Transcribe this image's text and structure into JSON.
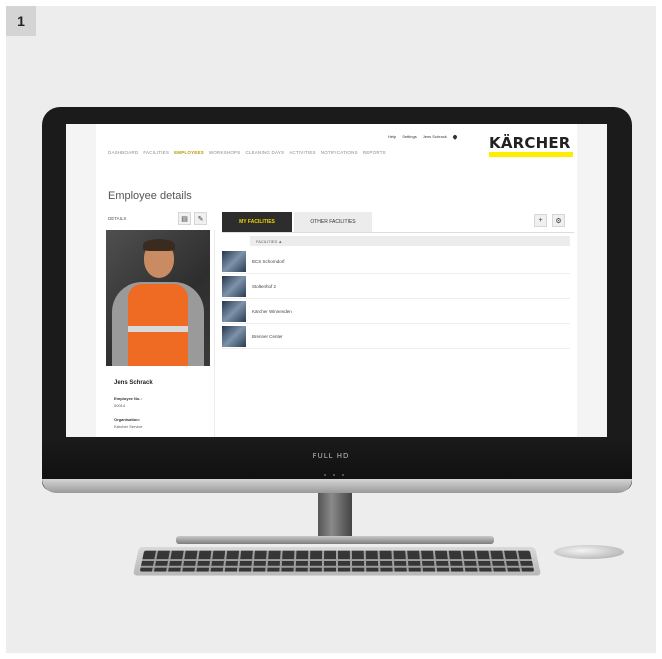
{
  "step_badge": "1",
  "monitor": {
    "brand_label": "FULL HD"
  },
  "app": {
    "util_nav": [
      "Help",
      "Settings",
      "Jens Schrack"
    ],
    "logo": "KÄRCHER",
    "logo_color": "#ffed00",
    "main_nav": [
      {
        "label": "DASHBOARD",
        "active": false
      },
      {
        "label": "FACILITIES",
        "active": false
      },
      {
        "label": "EMPLOYEES",
        "active": true
      },
      {
        "label": "WORKSHOPS",
        "active": false
      },
      {
        "label": "CLEANING DAYS",
        "active": false
      },
      {
        "label": "ACTIVITIES",
        "active": false
      },
      {
        "label": "NOTIFICATIONS",
        "active": false
      },
      {
        "label": "REPORTS",
        "active": false
      }
    ],
    "page_title": "Employee details",
    "details_label": "DETAILS",
    "employee": {
      "name": "Jens Schrack",
      "employee_no_label": "Employee No.:",
      "employee_no": "00014",
      "organisation_label": "Organisation:",
      "organisation": "Kärcher Service"
    },
    "tabs": [
      {
        "label": "MY FACILITIES",
        "active": true
      },
      {
        "label": "OTHER FACILITIES",
        "active": false
      }
    ],
    "table_header": "FACILITIES ▲",
    "facilities": [
      "BCS Schorndorf",
      "Stoltenhof 2",
      "Kärcher Winnenden",
      "Brenner Center"
    ],
    "icons": {
      "calendar": "calendar-icon",
      "edit": "pencil-icon",
      "add": "plus-icon",
      "settings": "gear-icon"
    }
  }
}
